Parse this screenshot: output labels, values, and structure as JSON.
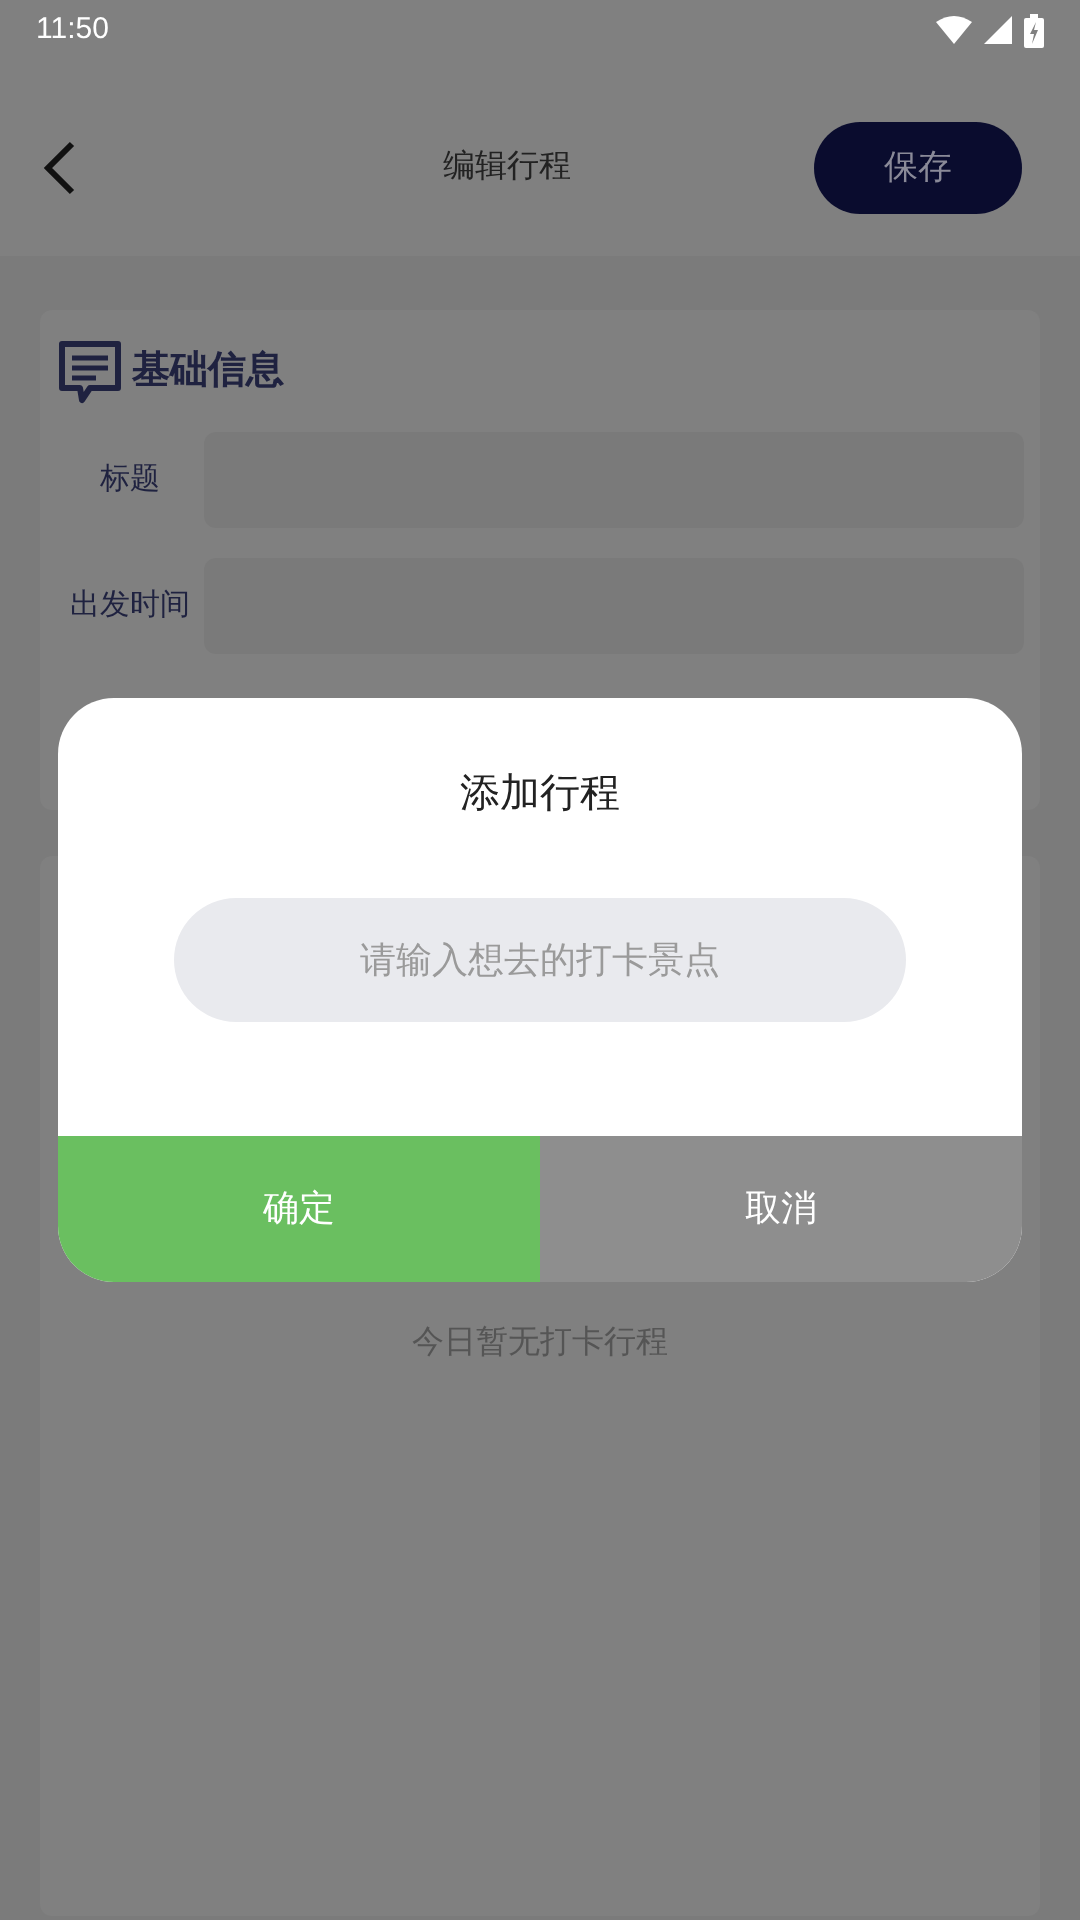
{
  "status_bar": {
    "time": "11:50"
  },
  "toolbar": {
    "title": "编辑行程",
    "save": "保存"
  },
  "basic_info": {
    "heading": "基础信息",
    "fields": [
      {
        "label": "标题"
      },
      {
        "label": "出发时间"
      }
    ]
  },
  "itinerary": {
    "empty_text": "今日暂无打卡行程"
  },
  "dialog": {
    "title": "添加行程",
    "placeholder": "请输入想去的打卡景点",
    "buttons": [
      {
        "label": "确定",
        "kind": "confirm"
      },
      {
        "label": "取消",
        "kind": "cancel"
      }
    ]
  }
}
